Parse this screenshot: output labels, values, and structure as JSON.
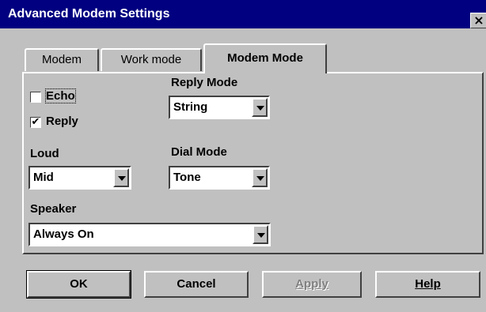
{
  "window": {
    "title": "Advanced Modem Settings",
    "close_label": "×"
  },
  "tabs": [
    {
      "label": "Modem",
      "active": false
    },
    {
      "label": "Work mode",
      "active": false
    },
    {
      "label": "Modem Mode",
      "active": true
    }
  ],
  "options": {
    "echo": {
      "label": "Echo",
      "checked": false
    },
    "reply": {
      "label": "Reply",
      "checked": true
    }
  },
  "reply_mode": {
    "label": "Reply Mode",
    "value": "String"
  },
  "loud": {
    "label": "Loud",
    "value": "Mid"
  },
  "dial_mode": {
    "label": "Dial Mode",
    "value": "Tone"
  },
  "speaker": {
    "label": "Speaker",
    "value": "Always On"
  },
  "buttons": {
    "ok": "OK",
    "cancel": "Cancel",
    "apply": "Apply",
    "help": "Help"
  }
}
